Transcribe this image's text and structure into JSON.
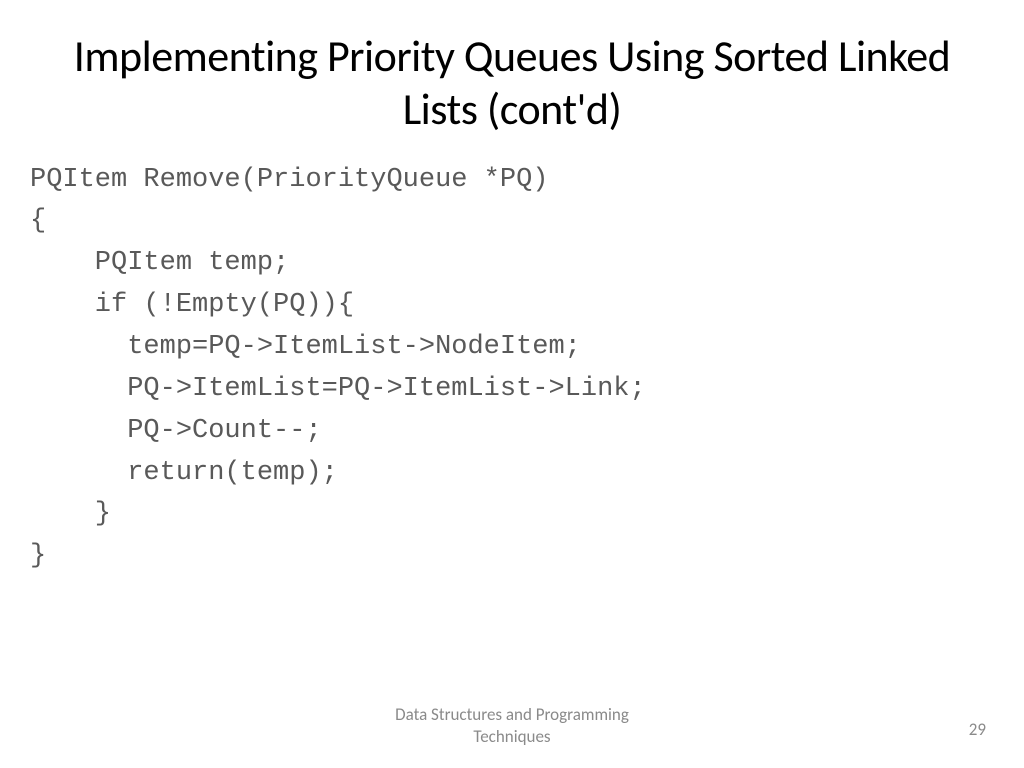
{
  "slide": {
    "title": "Implementing Priority Queues Using Sorted Linked Lists (cont'd)",
    "code": {
      "line1": "PQItem Remove(PriorityQueue *PQ)",
      "line2": "{",
      "line3": "    PQItem temp;",
      "line4": "    if (!Empty(PQ)){",
      "line5": "      temp=PQ->ItemList->NodeItem;",
      "line6": "      PQ->ItemList=PQ->ItemList->Link;",
      "line7": "      PQ->Count--;",
      "line8": "      return(temp);",
      "line9": "    }",
      "line10": "}"
    },
    "footer": {
      "line1": "Data Structures and Programming",
      "line2": "Techniques"
    },
    "page_number": "29"
  }
}
